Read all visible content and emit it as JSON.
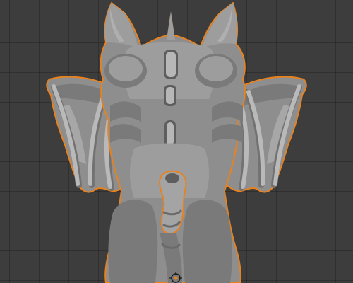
{
  "viewport": {
    "background_color": "#3d3d3d",
    "grid_color": "#2f2f2f",
    "selection_outline_color": "#e8821e",
    "mesh_color": "#8e8e8e",
    "object_icon": "dragon-mesh-icon",
    "origin_icon": "object-origin-icon",
    "selected": true
  }
}
